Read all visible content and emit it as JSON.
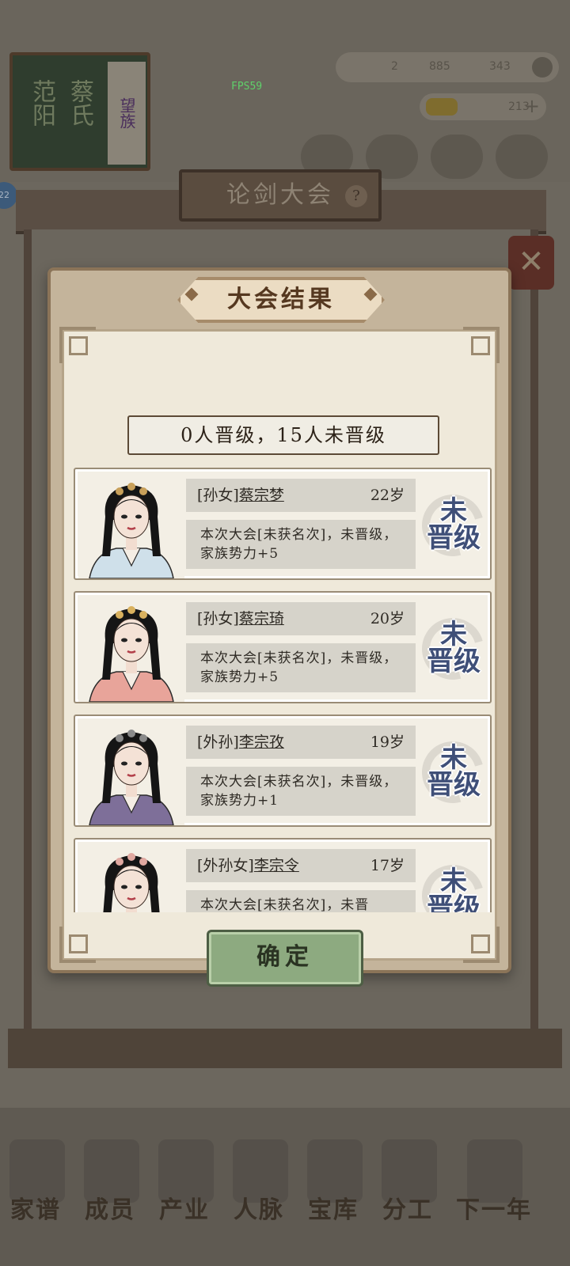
{
  "background": {
    "family_plaque": {
      "col1": "范阳",
      "col2": "蔡氏",
      "rank_tag": "望族"
    },
    "fps": "FPS59",
    "resources": {
      "r1": "2",
      "r2": "885",
      "r3": "343",
      "gold": "213"
    },
    "level_badge": "22",
    "pavilion_title": "论剑大会",
    "help_icon": "?",
    "close_icon": "✕",
    "nav": [
      "家谱",
      "成员",
      "产业",
      "人脉",
      "宝库",
      "分工",
      "下一年"
    ]
  },
  "dialog": {
    "title": "大会结果",
    "summary": "0人晋级，15人未晋级",
    "confirm_label": "确定",
    "stamp_top": "未",
    "stamp_bottom": "晋级",
    "members": [
      {
        "relation": "[孙女]",
        "name": "蔡宗梦",
        "age": "22岁",
        "desc": "本次大会[未获名次]，未晋级，家族势力+5",
        "robe": "#cfe0ea",
        "hair_ornament": "#c8a05a"
      },
      {
        "relation": "[孙女]",
        "name": "蔡宗琦",
        "age": "20岁",
        "desc": "本次大会[未获名次]，未晋级，家族势力+5",
        "robe": "#e8a49a",
        "hair_ornament": "#d9b15e"
      },
      {
        "relation": "[外孙]",
        "name": "李宗孜",
        "age": "19岁",
        "desc": "本次大会[未获名次]，未晋级，家族势力+1",
        "robe": "#7e6f99",
        "hair_ornament": "#8a8a8a"
      },
      {
        "relation": "[外孙女]",
        "name": "李宗令",
        "age": "17岁",
        "desc": "本次大会[未获名次]，未晋",
        "robe": "#e8c4b8",
        "hair_ornament": "#e0a8a0"
      }
    ]
  }
}
